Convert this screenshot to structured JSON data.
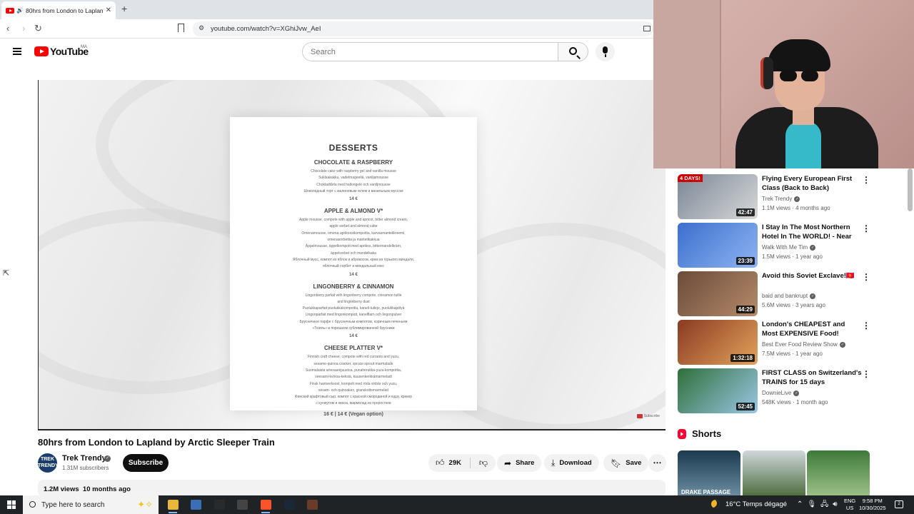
{
  "browser": {
    "tab_title": "80hrs from London to Laplan",
    "url": "youtube.com/watch?v=XGhiJvw_AeI"
  },
  "header": {
    "logo_text": "YouTube",
    "region": "MA",
    "search_placeholder": "Search"
  },
  "player": {
    "menu": {
      "title": "DESSERTS",
      "sections": [
        {
          "name": "CHOCOLATE & RASPBERRY",
          "lines": [
            "Chocolate cake with raspberry gel and vanilla mousse",
            "Suklaakakku, vadelmageeliä, vaniljamousse",
            "Chokladtårta med hallongelé och vaniljmousse",
            "Шоколадный торт с малиновым гелем и ванильным муссом"
          ],
          "price": "14 €"
        },
        {
          "name": "APPLE & ALMOND V*",
          "lines": [
            "Apple mousse, compote with apple and apricot, bitter almond cream,",
            "apple sorbet and almond cake",
            "Omenamousse, omena-aprikoosikompottia, karvasmantelikreemi,",
            "omenasorbettia ja mantelikakkua",
            "Äppelmousse, äppelkompott med aprikos, bittermandelkräm,",
            "äppelsorbet och mandelkaka",
            "Яблочный мусс, компот из яблок и абрикосов, крем из горького миндаля,",
            "яблочный сорбет и миндальный кекс"
          ],
          "price": "14 €"
        },
        {
          "name": "LINGONBERRY & CINNAMON",
          "lines": [
            "Lingonberry parfait with lingonberry compote, cinnamon tuille",
            "and lingonberry dust",
            "Puolukkaparfait puolukkakompottia, kaneli-tuilejo, puolukkapölyä",
            "Lingonparfait med lingonkompott, kanelflarn och lingonpulver",
            "Брусничное парфе с брусничным компотом, коричным печеньем",
            "«Тюиль» и порошком сублимированной брусники"
          ],
          "price": "14 €"
        },
        {
          "name": "CHEESE PLATTER V*",
          "lines": [
            "Finnish craft cheese, compote with red currants and yuzu,",
            "sesame-quinoa cracker, spruce sprout marmalade",
            "Suomalaista artesaanijuustoa, punaherukka-yuzu-kompottia,",
            "seesami-kvinoa-keksiä, kuusenkerkkämarmeladi",
            "Finsk hantverksost, kompott med röda vinbär och yuzu,",
            "sesam- och quinoakex, granskottsmarmelad",
            "Финский крафтовый сыр, компот с красной смородиной и юдзу, крекер",
            "с кунжутом и киноа, мармелад из проростков"
          ],
          "price": ""
        }
      ],
      "final_price": "16 €  |  14 € (Vegan option)"
    },
    "watermark": "Subscribe"
  },
  "video": {
    "title": "80hrs from London to Lapland by Arctic Sleeper Train",
    "channel": "Trek Trendy",
    "avatar_text": "TREK TRENDY",
    "subscribers": "1.31M subscribers",
    "subscribe_label": "Subscribe",
    "likes": "29K",
    "share_label": "Share",
    "download_label": "Download",
    "save_label": "Save",
    "views": "1.2M views",
    "age": "10 months ago"
  },
  "recommendations": [
    {
      "title": "Flying Every European First Class (Back to Back)",
      "channel": "Trek Trendy",
      "verified": true,
      "views": "1.1M views",
      "age": "4 months ago",
      "duration": "42:47",
      "badge": "4 DAYS!",
      "colors": [
        "#7a8796",
        "#d8d8d8"
      ]
    },
    {
      "title": "I Stay In The Most Northern Hotel In The WORLD! - Near The...",
      "channel": "Walk With Me Tim",
      "verified": true,
      "views": "1.5M views",
      "age": "1 year ago",
      "duration": "23:39",
      "badge": "",
      "colors": [
        "#3b6fd0",
        "#8fb4ef"
      ]
    },
    {
      "title": "Avoid this Soviet Exclave!🇰🇬",
      "channel": "baid and bankrupt",
      "verified": true,
      "views": "5.6M views",
      "age": "3 years ago",
      "duration": "44:29",
      "badge": "",
      "colors": [
        "#6b4b3a",
        "#b58b6a"
      ]
    },
    {
      "title": "London's CHEAPEST and Most EXPENSIVE Food! British Food...",
      "channel": "Best Ever Food Review Show",
      "verified": true,
      "views": "7.5M views",
      "age": "1 year ago",
      "duration": "1:32:18",
      "badge": "",
      "colors": [
        "#8a3a22",
        "#e2a35b"
      ]
    },
    {
      "title": "FIRST CLASS on Switzerland's TRAINS for 15 days",
      "channel": "DownieLive",
      "verified": true,
      "views": "548K views",
      "age": "1 month ago",
      "duration": "52:45",
      "badge": "",
      "colors": [
        "#2f6f3a",
        "#9ac7e6"
      ]
    }
  ],
  "shorts": {
    "heading": "Shorts",
    "items": [
      {
        "label": "DRAKE PASSAGE",
        "colors": [
          "#1b3a4f",
          "#6d8fa3"
        ]
      },
      {
        "label": "",
        "colors": [
          "#cfd8dc",
          "#4c6b3c"
        ]
      },
      {
        "label": "",
        "colors": [
          "#3e7a3a",
          "#9ec18a"
        ]
      }
    ]
  },
  "taskbar": {
    "search_placeholder": "Type here to search",
    "weather": "16°C  Temps dégagé",
    "lang_top": "ENG",
    "lang_bottom": "US",
    "time": "9:58 PM",
    "date": "10/30/2025",
    "notif_count": "2",
    "apps": [
      {
        "name": "file-explorer-icon",
        "color": "#e8b73c"
      },
      {
        "name": "calculator-icon",
        "color": "#3a6fb5"
      },
      {
        "name": "aw-app-icon",
        "color": "#2a2a2a"
      },
      {
        "name": "obs-icon",
        "color": "#444444"
      },
      {
        "name": "brave-icon",
        "color": "#fb542b"
      },
      {
        "name": "steam-icon",
        "color": "#1b2838"
      },
      {
        "name": "game-app-icon",
        "color": "#6b3b2a"
      }
    ]
  }
}
